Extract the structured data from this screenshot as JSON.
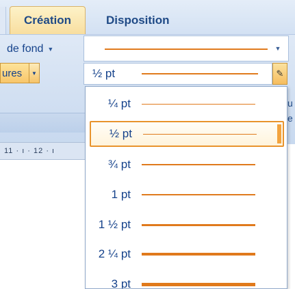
{
  "tabs": [
    {
      "label": "Création",
      "active": true
    },
    {
      "label": "Disposition",
      "active": false
    }
  ],
  "ribbon": {
    "shading_label": "de fond",
    "borders_label": "ures",
    "ruler_text": "11 · ı · 12 · ı",
    "right_glyphs": "u\ne"
  },
  "border_style": {
    "selected_line_color": "#e07a1c"
  },
  "border_weight": {
    "current": "½ pt",
    "options": [
      {
        "label": "¼ pt",
        "weight_pt": 0.25,
        "selected": false
      },
      {
        "label": "½ pt",
        "weight_pt": 0.5,
        "selected": true
      },
      {
        "label": "¾ pt",
        "weight_pt": 0.75,
        "selected": false
      },
      {
        "label": "1 pt",
        "weight_pt": 1,
        "selected": false
      },
      {
        "label": "1 ½ pt",
        "weight_pt": 1.5,
        "selected": false
      },
      {
        "label": "2 ¼ pt",
        "weight_pt": 2.25,
        "selected": false
      },
      {
        "label": "3 pt",
        "weight_pt": 3,
        "selected": false
      }
    ]
  },
  "colors": {
    "accent_orange": "#e07a1c",
    "label_blue": "#15428b",
    "highlight_border": "#e8932c"
  }
}
